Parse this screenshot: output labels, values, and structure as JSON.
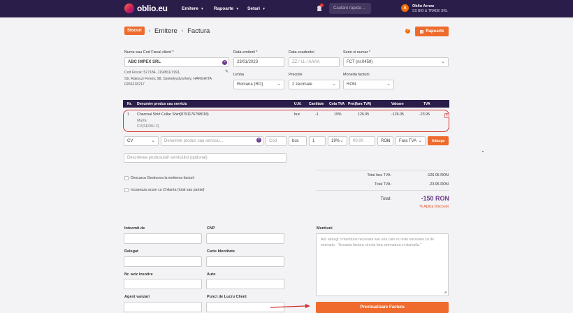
{
  "topbar": {
    "brand": "oblio.eu",
    "nav": [
      "Emitere",
      "Rapoarte",
      "Setari"
    ],
    "search_placeholder": "Cautare rapida ...",
    "user_name": "Oblio Arrow",
    "user_company": "SS BIO & TRADE SRL",
    "user_initial": "A"
  },
  "breadcrumb": {
    "badge": "Stocuri",
    "items": [
      "Emitere",
      "Factura"
    ],
    "help": "?",
    "reports_button": "Rapoarte"
  },
  "client": {
    "label": "Nume sau Cod Fiscal client *",
    "value": "ABC IMPEX SRL",
    "address_lines": [
      "Cod Fiscal: 527184, J19/861/1991,",
      "Str. Rakoczi Ferenc 98, Szekelyudvarhely, HARGHITA",
      "0266218217"
    ]
  },
  "fields": {
    "issue_date_label": "Data emiterii *",
    "issue_date": "23/01/2023",
    "due_date_label": "Data scadentei",
    "due_date_placeholder": "ZZ / LL / AAAA",
    "series_label": "Serie si numar *",
    "series_value": "FCT (nr.0459)",
    "language_label": "Limba",
    "language_value": "Romana (RO)",
    "precision_label": "Precizie",
    "precision_value": "2 zecimale",
    "currency_label": "Moneda facturii",
    "currency_value": "RON"
  },
  "table": {
    "headers": [
      "Nr.",
      "Denumire produs sau serviciu",
      "U.M.",
      "Cantitate",
      "Cota TVA",
      "Pret(fara TVA)",
      "Valoare",
      "TVA"
    ],
    "row": {
      "nr": "1",
      "name": "Charcoal Shirt Collar Shirt(8791176798018)",
      "sub1": "Marfa",
      "sub2": "CV(SEDIU 2)",
      "um": "buc",
      "qty": "-1",
      "vat_rate": "19%",
      "price": "126.05",
      "value": "-126.05",
      "vat": "-23.95"
    }
  },
  "add_line": {
    "type": "CV",
    "name_placeholder": "Denumire produs sau serviciu...",
    "code_placeholder": "Cod",
    "um": "buc",
    "qty": "1",
    "vat": "19%",
    "price_placeholder": "00.00",
    "currency": "RON",
    "vat_mode": "Fara TVA",
    "add_button": "Adauga",
    "description_placeholder": "Descrierea produsului/ serviciului (optional)"
  },
  "options": {
    "stock_discharge": "Descarca Gestiunea la emiterea facturii",
    "receipt": "Incaseaza acum cu Chitanta (total sau partial)"
  },
  "totals": {
    "no_vat_label": "Total fara TVA:",
    "no_vat_value": "-126.05 RON",
    "vat_label": "Total TVA:",
    "vat_value": "-23.95 RON",
    "total_label": "Total:",
    "total_value": "-150 RON",
    "discount_link": "% Aplica Discount"
  },
  "footer": {
    "drawn_by": "Intocmit de",
    "cnp": "CNP",
    "delegate": "Delegat",
    "id_card": "Carte Identitate",
    "notice_nr": "Nr. aviz insotire",
    "car": "Auto",
    "sales_agent": "Agent vanzari",
    "work_point": "Punct de Lucru Client",
    "mentions_label": "Mentiuni",
    "mentions_placeholder": "Aici adaugi o mentiune necesara sau una care nu este necesara ca de exemplu : \"Aceasta factura circula fara semnatura si stampila.\"",
    "submit_button": "Previzualizare Factura"
  }
}
